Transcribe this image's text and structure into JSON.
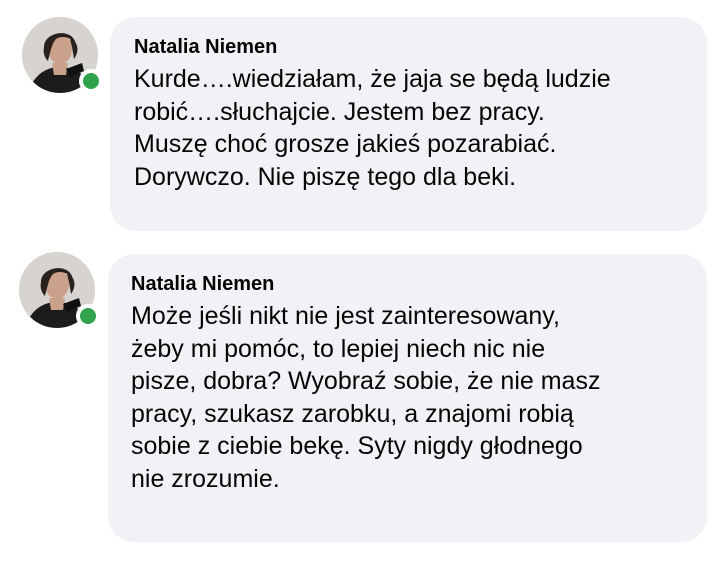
{
  "comments": [
    {
      "author": "Natalia Niemen",
      "lines": [
        "Kurde….wiedziałam, że jaja se będą ludzie",
        "robić….słuchajcie. Jestem bez pracy.",
        "Muszę choć grosze jakieś pozarabiać.",
        "Dorywczo. Nie piszę tego dla beki."
      ]
    },
    {
      "author": "Natalia Niemen",
      "lines": [
        "Może jeśli nikt nie jest zainteresowany,",
        "żeby mi pomóc, to lepiej niech nic nie",
        "pisze, dobra? Wyobraź sobie, że nie masz",
        "pracy, szukasz zarobku, a znajomi robią",
        "sobie z ciebie bekę. Syty nigdy głodnego",
        "nie zrozumie."
      ]
    }
  ],
  "colors": {
    "bubble": "#f0f2f5",
    "online": "#31a24c",
    "text": "#050505"
  }
}
